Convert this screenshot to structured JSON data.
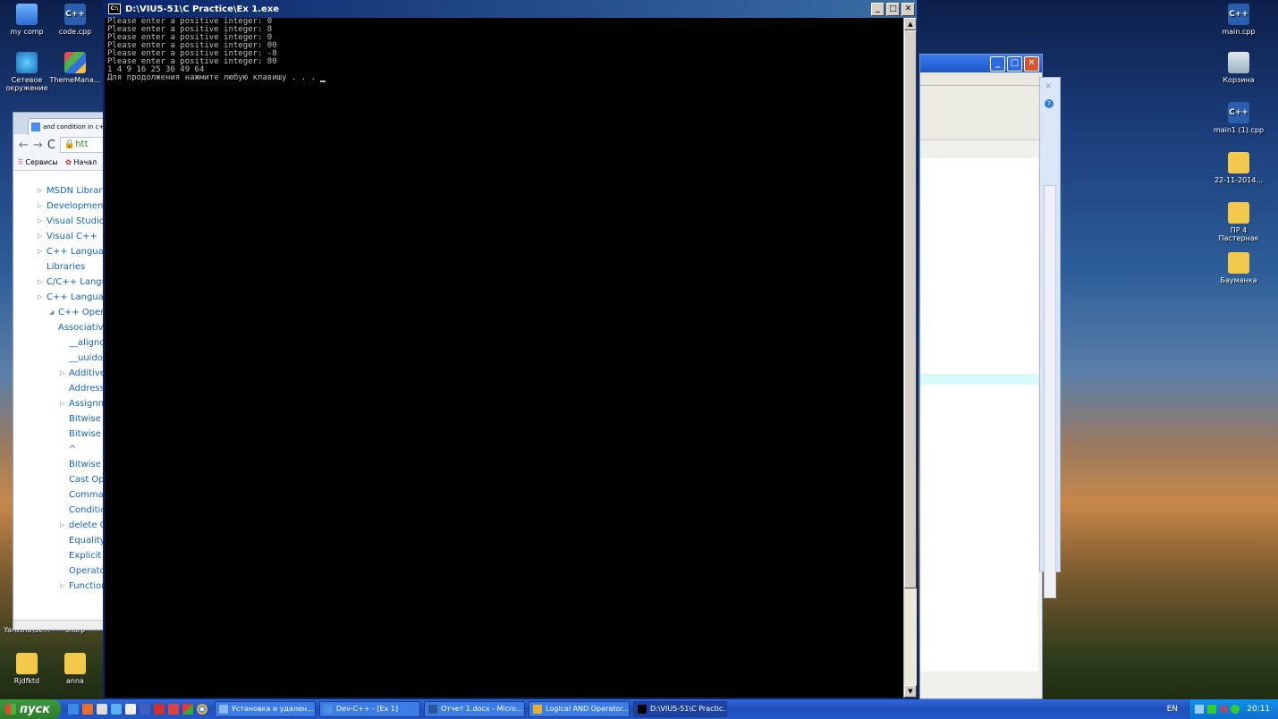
{
  "desktop_left": [
    {
      "label": "my comp",
      "icon": "monitor"
    },
    {
      "label": "code.cpp",
      "icon": "cpp"
    },
    {
      "label": "Сетевое окружение",
      "icon": "net"
    },
    {
      "label": "ThemeMana...",
      "icon": "theme"
    },
    {
      "label": "Yarusha\\Se...",
      "icon": "folder"
    },
    {
      "label": "sharp",
      "icon": "folder"
    },
    {
      "label": "Rjdfktd",
      "icon": "folder"
    },
    {
      "label": "anna",
      "icon": "folder"
    }
  ],
  "desktop_right": [
    {
      "label": "main.cpp",
      "icon": "cpp"
    },
    {
      "label": "Корзина",
      "icon": "recycle-bin"
    },
    {
      "label": "main1 (1).cpp",
      "icon": "cpp"
    },
    {
      "label": "22-11-2014...",
      "icon": "zip-folder"
    },
    {
      "label": "ПР 4 Пастернак",
      "icon": "folder"
    },
    {
      "label": "Бауманка",
      "icon": "folder"
    }
  ],
  "browser": {
    "tab_title": "and condition in c++",
    "address": "htt",
    "bookmarks": [
      "Сервисы",
      "Начал"
    ],
    "toc": [
      {
        "label": "MSDN Library",
        "level": 0,
        "arrow": "▷"
      },
      {
        "label": "Development",
        "level": 0,
        "arrow": "▷"
      },
      {
        "label": "Visual Studio ...",
        "level": 0,
        "arrow": "▷"
      },
      {
        "label": "Visual C++",
        "level": 0,
        "arrow": "▷"
      },
      {
        "label": "C++ Languag",
        "level": 0,
        "arrow": "▷"
      },
      {
        "label": "Libraries",
        "level": 0,
        "arrow": ""
      },
      {
        "label": "C/C++ Langu",
        "level": 0,
        "arrow": "▷"
      },
      {
        "label": "C++ Languag",
        "level": 0,
        "arrow": "▷"
      },
      {
        "label": "C++ Opera",
        "level": 1,
        "arrow": "◢"
      },
      {
        "label": "Associativit",
        "level": 1,
        "arrow": ""
      },
      {
        "label": "__alignof",
        "level": 2,
        "arrow": ""
      },
      {
        "label": "__uuidof",
        "level": 2,
        "arrow": ""
      },
      {
        "label": "Additive",
        "level": 2,
        "arrow": "▷"
      },
      {
        "label": "Address",
        "level": 2,
        "arrow": ""
      },
      {
        "label": "Assignm",
        "level": 2,
        "arrow": "▷"
      },
      {
        "label": "Bitwise A",
        "level": 2,
        "arrow": ""
      },
      {
        "label": "Bitwise E",
        "level": 2,
        "arrow": ""
      },
      {
        "label": "^",
        "level": 2,
        "arrow": ""
      },
      {
        "label": "Bitwise I",
        "level": 2,
        "arrow": ""
      },
      {
        "label": "Cast Op",
        "level": 2,
        "arrow": ""
      },
      {
        "label": "Comma",
        "level": 2,
        "arrow": ""
      },
      {
        "label": "Conditio",
        "level": 2,
        "arrow": ""
      },
      {
        "label": "delete O",
        "level": 2,
        "arrow": "▷"
      },
      {
        "label": "Equality",
        "level": 2,
        "arrow": ""
      },
      {
        "label": "Explicit T",
        "level": 2,
        "arrow": ""
      },
      {
        "label": "Operato",
        "level": 2,
        "arrow": ""
      },
      {
        "label": "Function",
        "level": 2,
        "arrow": "▷"
      }
    ]
  },
  "console": {
    "title": "D:\\VIU5-51\\C Practice\\Ex 1.exe",
    "icon_text": "C:\\",
    "lines": [
      "Please enter a positive integer: 0",
      "Please enter a positive integer: 8",
      "Please enter a positive integer: 0",
      "Please enter a positive integer: 00",
      "Please enter a positive integer: -8",
      "Please enter a positive integer: 80",
      "1 4 9 16 25 36 49 64",
      "Для продолжения нажмите любую клавишу . . . "
    ]
  },
  "taskbar": {
    "start_label": "пуск",
    "tasks": [
      {
        "label": "Установка и удален...",
        "color": "#8ab8f0",
        "active": false
      },
      {
        "label": "Dev-C++ - [Ex 1]",
        "color": "#4a90e0",
        "active": false
      },
      {
        "label": "Отчет 1.docx - Micro...",
        "color": "#2b5797",
        "active": false
      },
      {
        "label": "Logical AND Operator...",
        "color": "#e8b030",
        "active": false
      },
      {
        "label": "D:\\VIU5-51\\C Practic...",
        "color": "#000000",
        "active": true
      }
    ],
    "lang": "EN",
    "clock": "20:11"
  }
}
